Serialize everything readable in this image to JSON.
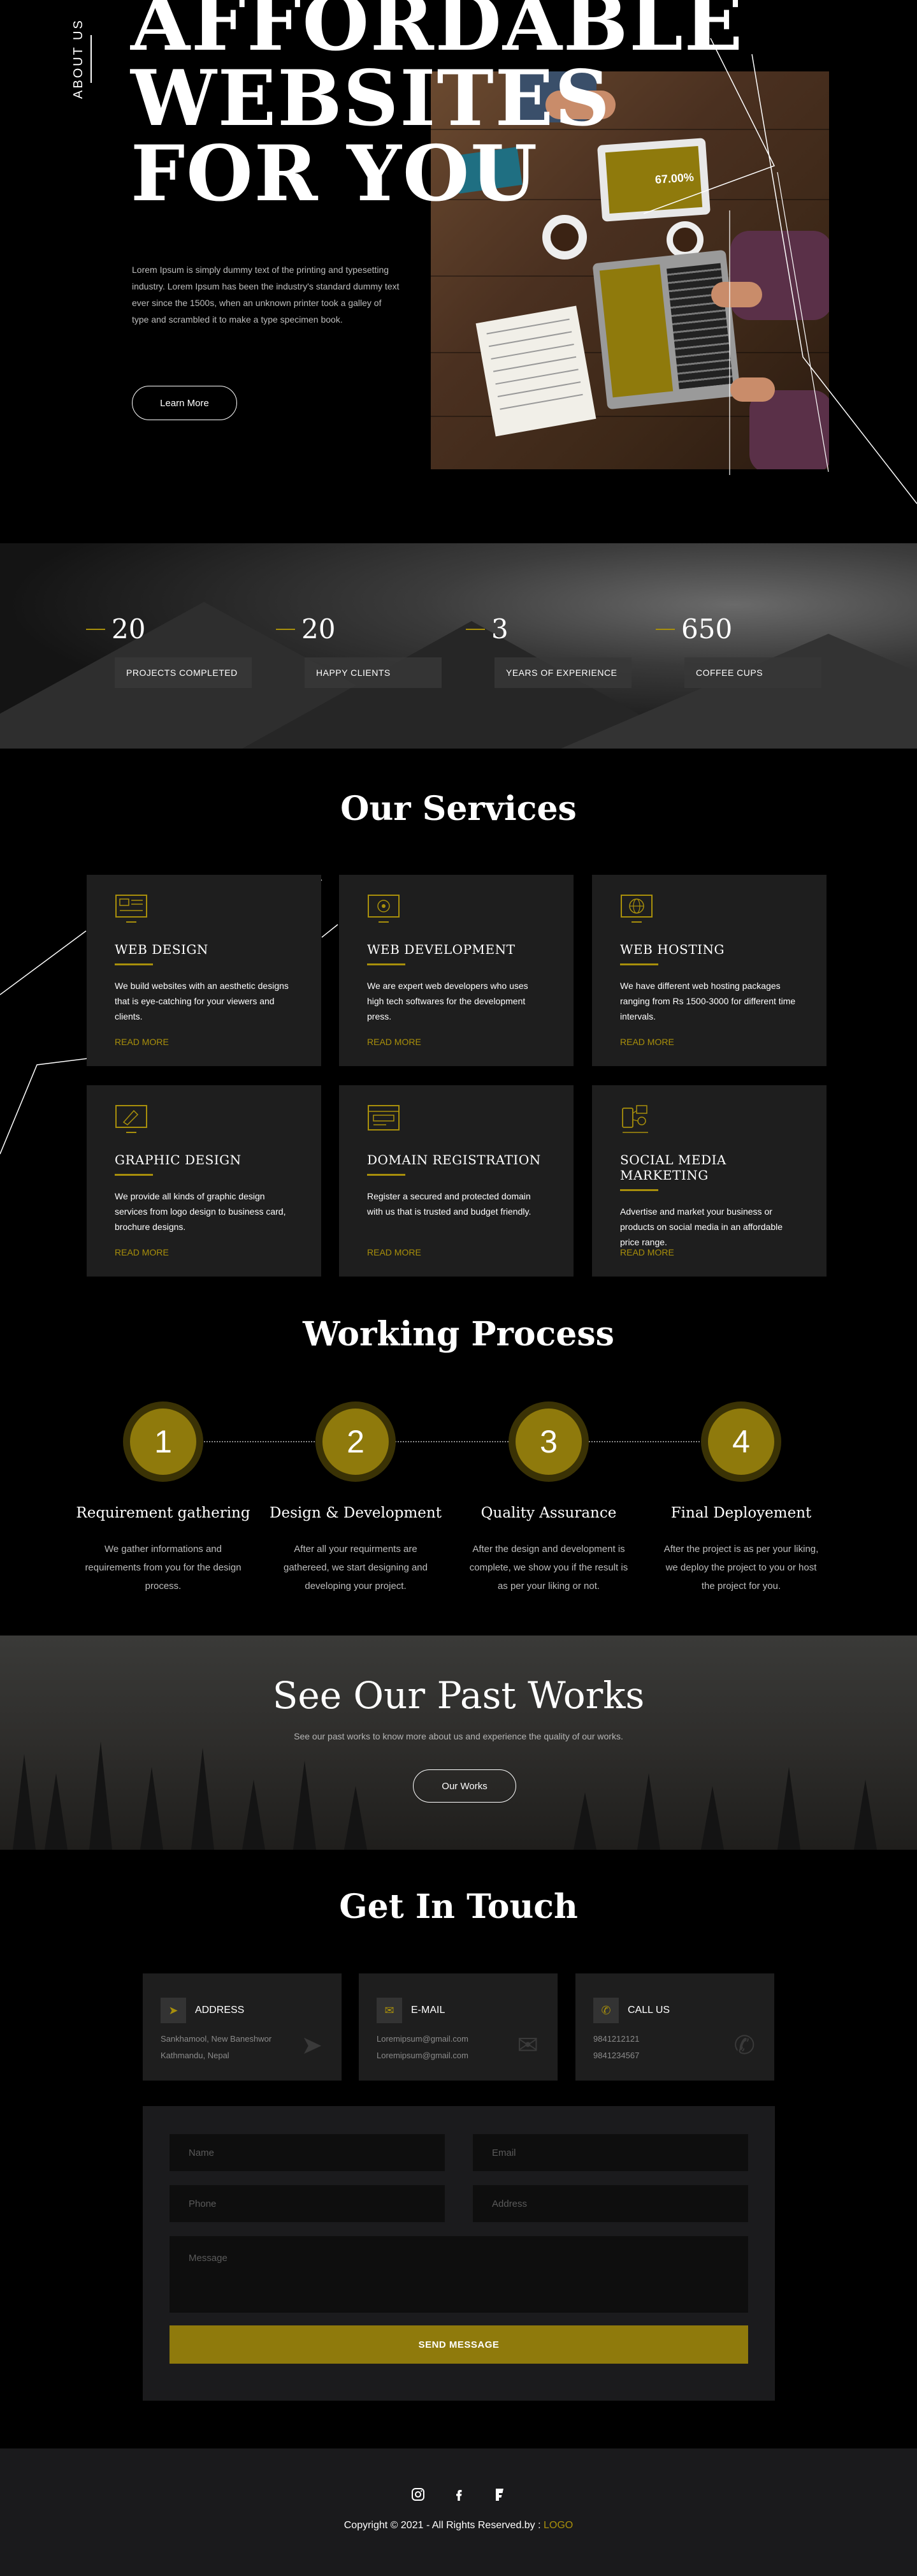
{
  "hero": {
    "about_label": "ABOUT US",
    "title_line1": "AFFORDABLE",
    "title_line2": "WEBSITES",
    "title_line3": "FOR YOU",
    "description": "Lorem Ipsum is simply dummy text of the printing and typesetting industry. Lorem Ipsum has been the industry's standard dummy text ever since the 1500s, when an unknown printer took a galley of type and scrambled it to make a type specimen book.",
    "button_label": "Learn More",
    "tablet_text": "67.00%"
  },
  "stats": [
    {
      "number": "20",
      "label": "PROJECTS COMPLETED"
    },
    {
      "number": "20",
      "label": "HAPPY CLIENTS"
    },
    {
      "number": "3",
      "label": "YEARS OF EXPERIENCE"
    },
    {
      "number": "650",
      "label": "COFFEE CUPS"
    }
  ],
  "services": {
    "title": "Our Services",
    "items": [
      {
        "icon": "web-design-icon",
        "title": "WEB DESIGN",
        "text": "We build websites with an aesthetic designs that is eye-catching for your viewers and clients.",
        "link": "READ MORE"
      },
      {
        "icon": "web-development-icon",
        "title": "WEB DEVELOPMENT",
        "text": "We are expert web developers who uses high tech softwares for the development press.",
        "link": "READ MORE"
      },
      {
        "icon": "web-hosting-icon",
        "title": "WEB HOSTING",
        "text": "We have different web hosting packages ranging from Rs 1500-3000 for different time intervals.",
        "link": "READ MORE"
      },
      {
        "icon": "graphic-design-icon",
        "title": "GRAPHIC DESIGN",
        "text": "We provide all kinds of graphic design services from logo design to business card, brochure designs.",
        "link": "READ MORE"
      },
      {
        "icon": "domain-registration-icon",
        "title": "DOMAIN REGISTRATION",
        "text": "Register a secured and protected domain with us that is trusted and budget friendly.",
        "link": "READ MORE"
      },
      {
        "icon": "social-media-icon",
        "title": "SOCIAL MEDIA MARKETING",
        "text": "Advertise and market your business or products on social media in an affordable price range.",
        "link": "READ MORE"
      }
    ]
  },
  "process": {
    "title": "Working Process",
    "steps": [
      {
        "number": "1",
        "title": "Requirement gathering",
        "text": "We gather informations and requirements from you for the design process."
      },
      {
        "number": "2",
        "title": "Design & Development",
        "text": "After all your requirments are gathereed, we start designing and developing your project."
      },
      {
        "number": "3",
        "title": "Quality Assurance",
        "text": "After the design and development is complete, we show you if the result is as per your liking or not."
      },
      {
        "number": "4",
        "title": "Final Deployement",
        "text": "After the project is as per your liking, we deploy the project to you or host the project for you."
      }
    ]
  },
  "works": {
    "title": "See Our Past Works",
    "subtitle": "See our past works to know more about us and experience the quality of our works.",
    "button_label": "Our Works"
  },
  "contact": {
    "title": "Get In Touch",
    "cards": [
      {
        "icon": "location-arrow-icon",
        "title": "ADDRESS",
        "lines": [
          "Sankhamool, New Baneshwor",
          "Kathmandu, Nepal"
        ]
      },
      {
        "icon": "envelope-icon",
        "title": "E-MAIL",
        "lines": [
          "Loremipsum@gmail.com",
          "Loremipsum@gmail.com"
        ]
      },
      {
        "icon": "phone-icon",
        "title": "CALL US",
        "lines": [
          "9841212121",
          "9841234567"
        ]
      }
    ],
    "form": {
      "name_placeholder": "Name",
      "email_placeholder": "Email",
      "phone_placeholder": "Phone",
      "address_placeholder": "Address",
      "message_placeholder": "Message",
      "submit_label": "SEND MESSAGE"
    }
  },
  "footer": {
    "copyright": "Copyright © 2021 - All Rights Reserved.by : ",
    "logo": "LOGO"
  },
  "colors": {
    "accent": "#a88f0b",
    "accent_dark": "#8f7a0c",
    "background": "#000000",
    "card": "#1e1e1e"
  }
}
